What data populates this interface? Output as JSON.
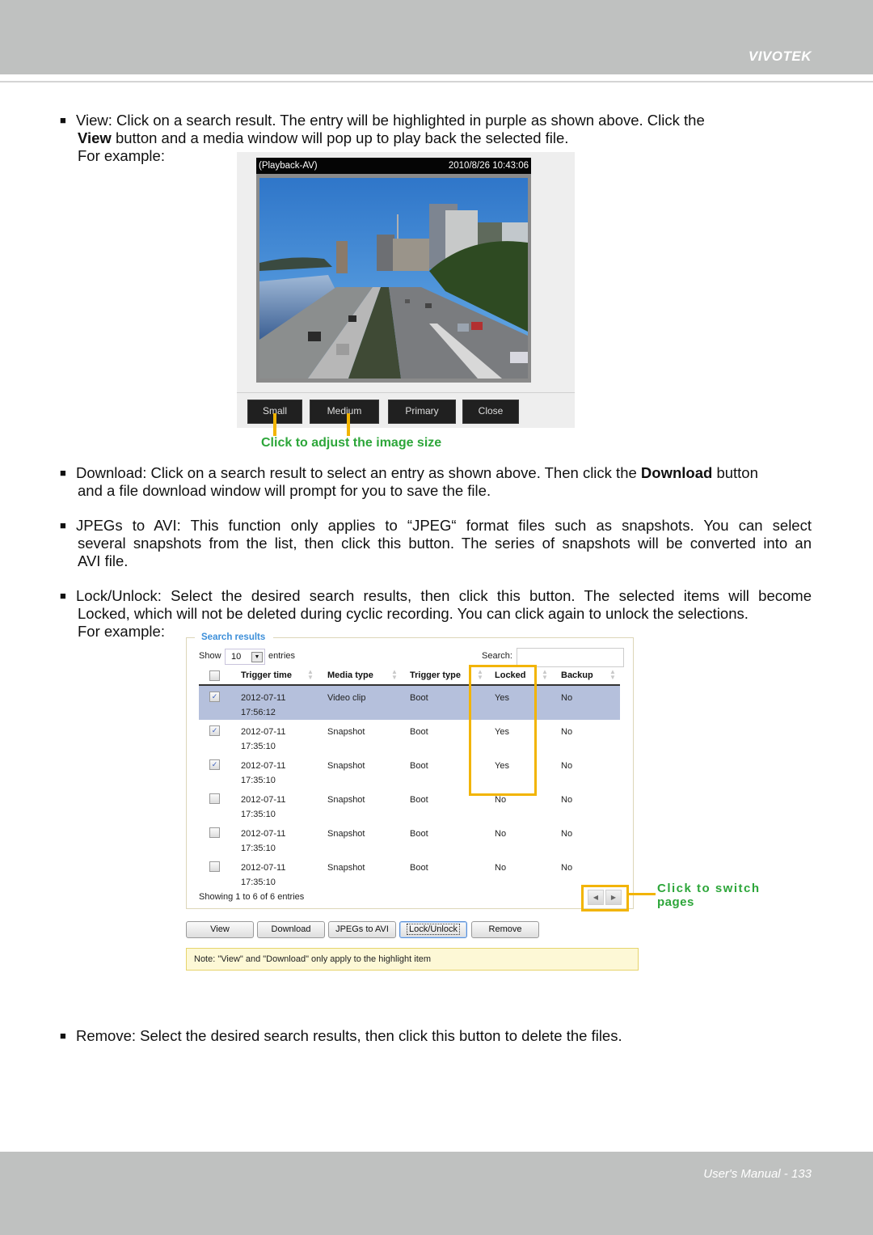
{
  "header": {
    "brand": "VIVOTEK"
  },
  "footer": {
    "page_label": "User's Manual - 133"
  },
  "sections": {
    "view": {
      "bullet": "■",
      "label": "View",
      "line1": "View: Click on a search result. The entry will be highlighted in purple as shown above. Click the",
      "line2_bold": "View",
      "line2_rest": " button and a media window will pop up to play back the selected file.",
      "example": "For example:"
    },
    "download": {
      "bullet": "■",
      "text_before": "Download: Click on a search result to select an entry as shown above. Then click the ",
      "bold": "Download",
      "text_after": " button",
      "line2": "and a file download window will prompt for you to save the file."
    },
    "jpegs": {
      "bullet": "■",
      "line1": "JPEGs to AVI: This function only applies to “JPEG“ format files such as snapshots. You can select",
      "line2": "several snapshots from the list, then click this button. The series of snapshots will be converted into an",
      "line3": "AVI file."
    },
    "lock": {
      "bullet": "■",
      "line1": "Lock/Unlock: Select the desired search results, then click this button. The selected items will become",
      "line2": "Locked, which will not be deleted during cyclic recording. You can click again to unlock the selections.",
      "example": "For example:"
    },
    "remove": {
      "bullet": "■",
      "text": "Remove: Select the desired search results, then click this button to delete the files."
    }
  },
  "media_window": {
    "title_left": "(Playback-AV)",
    "title_right": "2010/8/26 10:43:06",
    "buttons": [
      "Small",
      "Medium",
      "Primary",
      "Close"
    ],
    "callout": "Click to adjust the image size"
  },
  "search_results": {
    "title": "Search results",
    "show_label": "Show",
    "show_value": "10",
    "entries_label": "entries",
    "search_label": "Search:",
    "search_value": "",
    "columns": [
      "Trigger time",
      "Media type",
      "Trigger type",
      "Locked",
      "Backup"
    ],
    "rows": [
      {
        "checked": true,
        "highlighted": true,
        "date": "2012-07-11",
        "time": "17:56:12",
        "media": "Video clip",
        "trigger": "Boot",
        "locked": "Yes",
        "backup": "No"
      },
      {
        "checked": true,
        "highlighted": false,
        "date": "2012-07-11",
        "time": "17:35:10",
        "media": "Snapshot",
        "trigger": "Boot",
        "locked": "Yes",
        "backup": "No"
      },
      {
        "checked": true,
        "highlighted": false,
        "date": "2012-07-11",
        "time": "17:35:10",
        "media": "Snapshot",
        "trigger": "Boot",
        "locked": "Yes",
        "backup": "No"
      },
      {
        "checked": false,
        "highlighted": false,
        "date": "2012-07-11",
        "time": "17:35:10",
        "media": "Snapshot",
        "trigger": "Boot",
        "locked": "No",
        "backup": "No"
      },
      {
        "checked": false,
        "highlighted": false,
        "date": "2012-07-11",
        "time": "17:35:10",
        "media": "Snapshot",
        "trigger": "Boot",
        "locked": "No",
        "backup": "No"
      },
      {
        "checked": false,
        "highlighted": false,
        "date": "2012-07-11",
        "time": "17:35:10",
        "media": "Snapshot",
        "trigger": "Boot",
        "locked": "No",
        "backup": "No"
      }
    ],
    "info": "Showing 1 to 6 of 6 entries",
    "pager_callout": "Click to switch pages",
    "pager_callout_line1": "Click to switch",
    "pager_callout_line2": "pages",
    "actions": [
      "View",
      "Download",
      "JPEGs to AVI",
      "Lock/Unlock",
      "Remove"
    ],
    "focused_action": "Lock/Unlock",
    "note": "Note: \"View\" and \"Download\" only apply to the highlight item"
  },
  "colors": {
    "header_bg": "#bfc1c0",
    "highlight_row": "#b5c0dc",
    "callout_orange": "#f2b400",
    "callout_green": "#2da63a",
    "search_title_blue": "#3d8fd9",
    "note_bg": "#fdf8d6"
  }
}
